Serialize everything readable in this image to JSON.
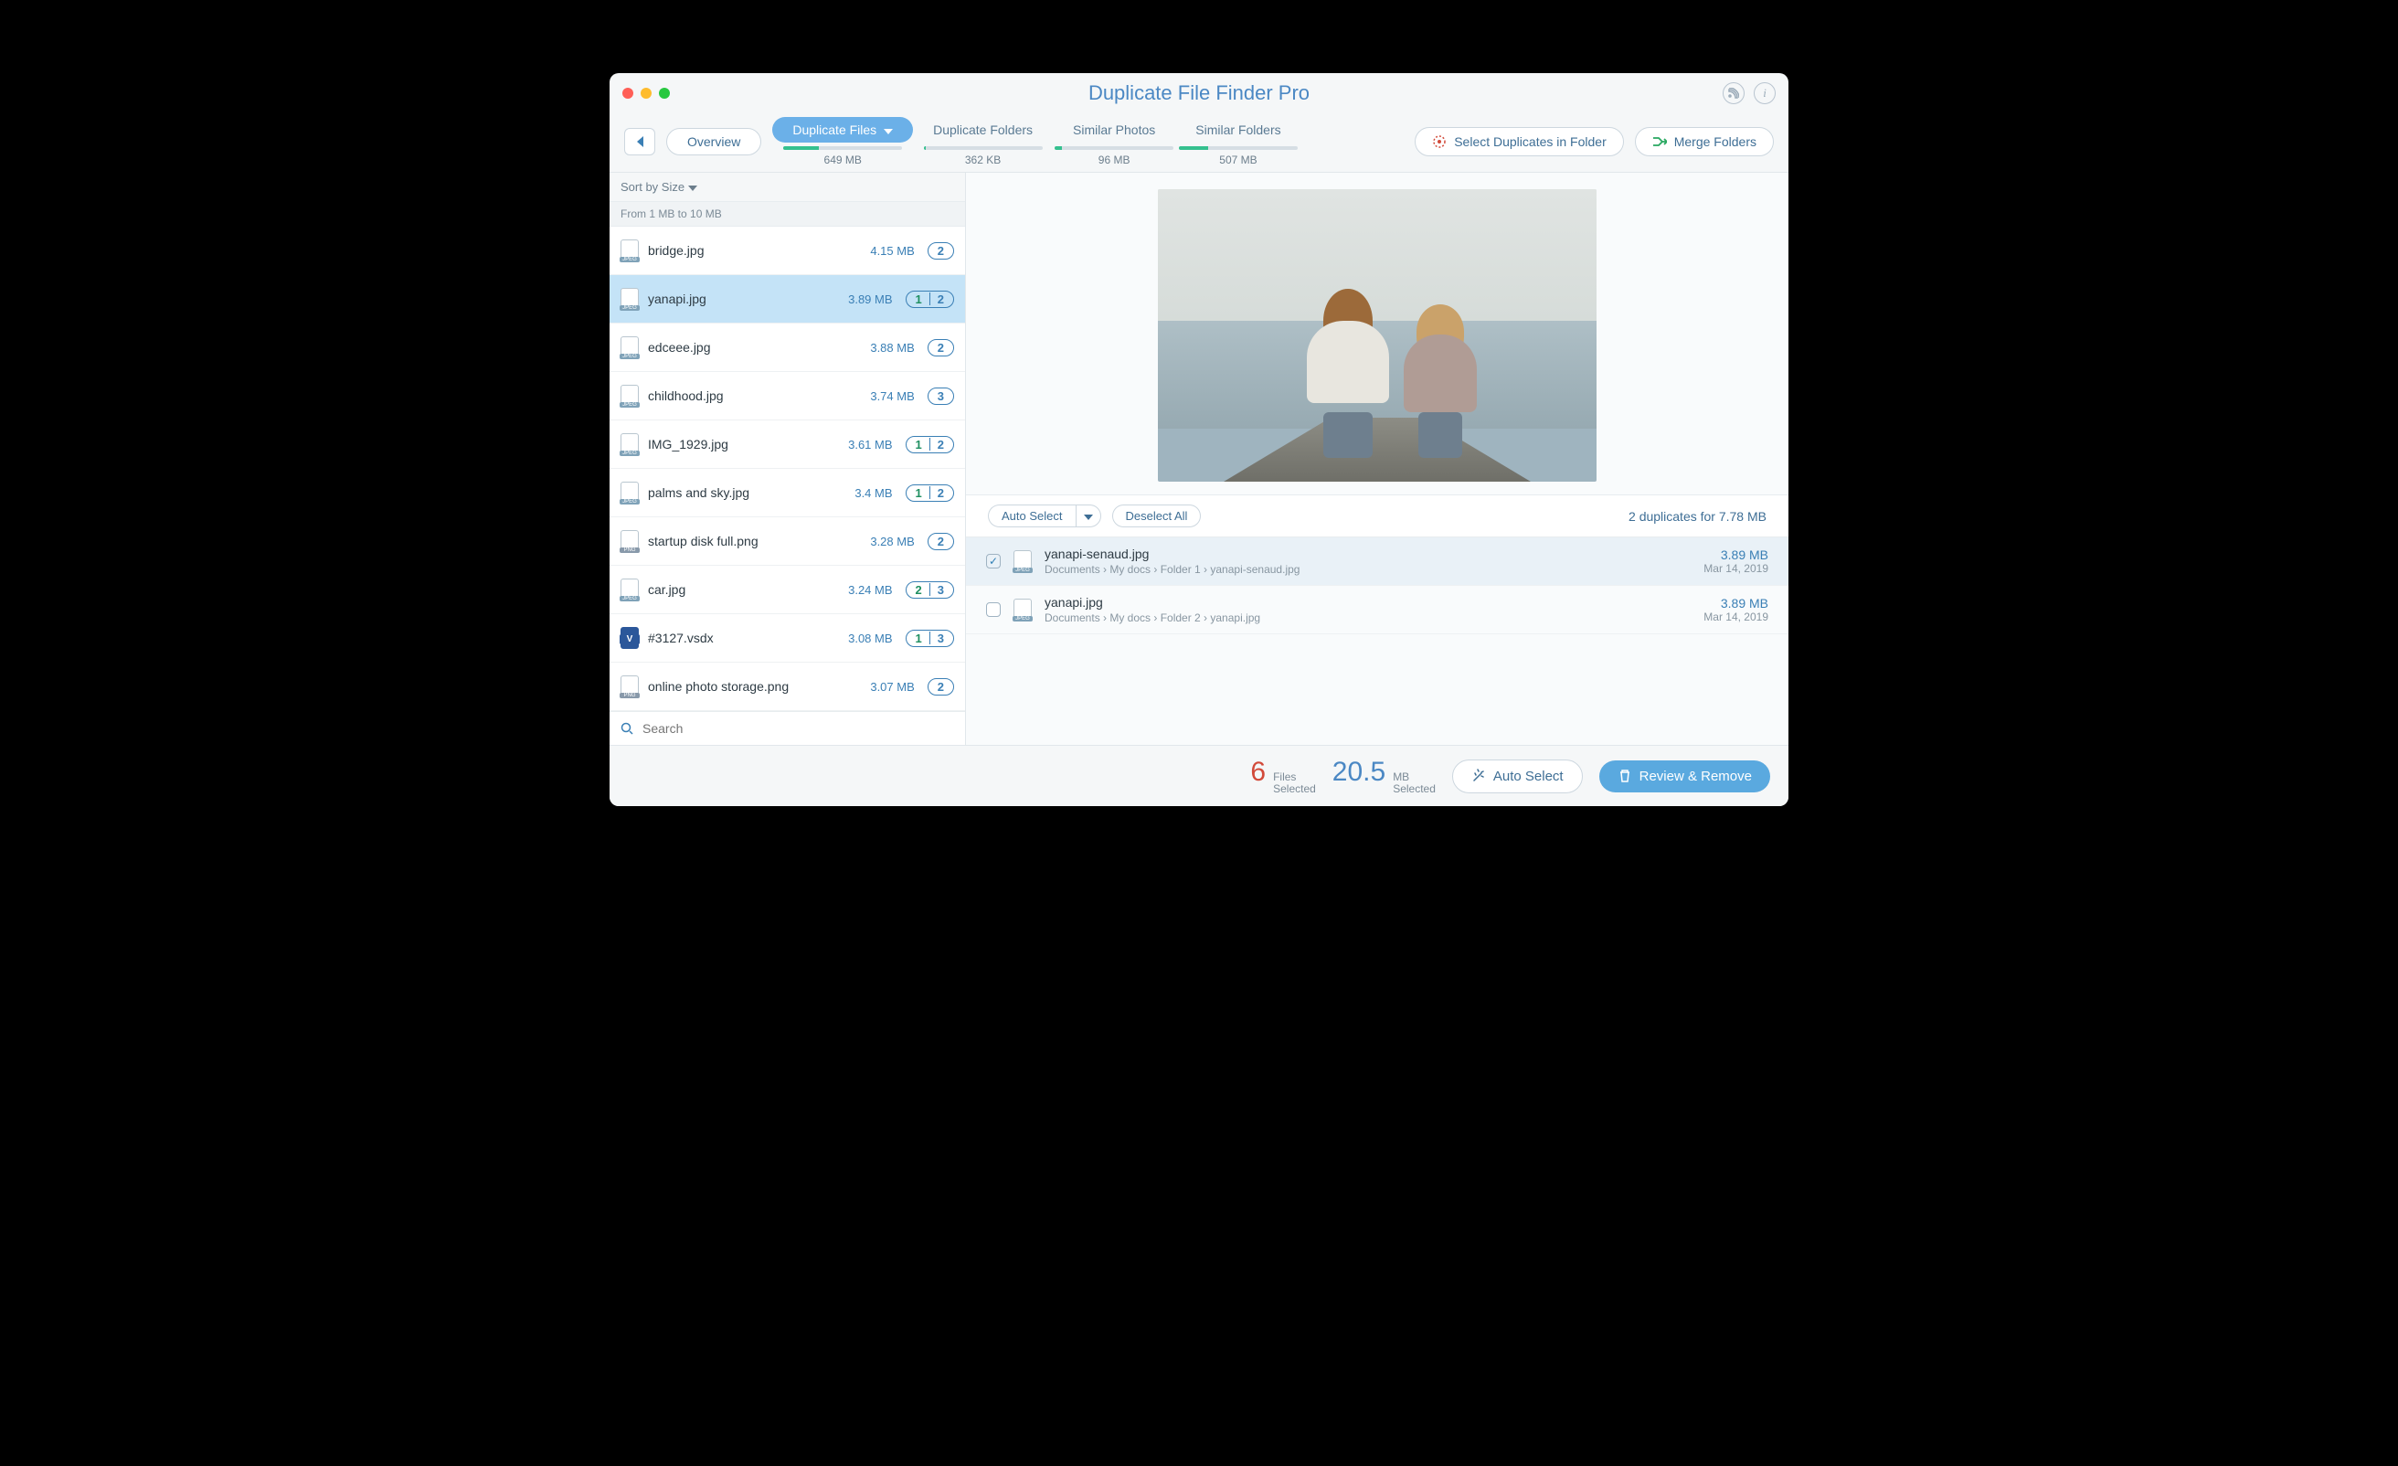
{
  "title": "Duplicate File Finder Pro",
  "nav": {
    "overview": "Overview",
    "tabs": [
      {
        "label": "Duplicate Files",
        "size": "649 MB",
        "fill": 30,
        "active": true
      },
      {
        "label": "Duplicate Folders",
        "size": "362 KB",
        "fill": 2,
        "active": false
      },
      {
        "label": "Similar Photos",
        "size": "96 MB",
        "fill": 6,
        "active": false
      },
      {
        "label": "Similar Folders",
        "size": "507 MB",
        "fill": 25,
        "active": false
      }
    ],
    "select_in_folder": "Select Duplicates in Folder",
    "merge": "Merge Folders"
  },
  "sidebar": {
    "sort": "Sort by Size",
    "group": "From 1 MB to 10 MB",
    "search_placeholder": "Search",
    "items": [
      {
        "name": "bridge.jpg",
        "size": "4.15 MB",
        "badge": [
          "2"
        ],
        "type": "jpeg"
      },
      {
        "name": "yanapi.jpg",
        "size": "3.89 MB",
        "badge": [
          "1",
          "2"
        ],
        "type": "jpeg",
        "selected": true,
        "first_on": true
      },
      {
        "name": "edceee.jpg",
        "size": "3.88 MB",
        "badge": [
          "2"
        ],
        "type": "jpeg"
      },
      {
        "name": "childhood.jpg",
        "size": "3.74 MB",
        "badge": [
          "3"
        ],
        "type": "jpeg"
      },
      {
        "name": "IMG_1929.jpg",
        "size": "3.61 MB",
        "badge": [
          "1",
          "2"
        ],
        "type": "jpeg",
        "first_on": true
      },
      {
        "name": "palms and sky.jpg",
        "size": "3.4 MB",
        "badge": [
          "1",
          "2"
        ],
        "type": "jpeg",
        "first_on": true
      },
      {
        "name": "startup disk full.png",
        "size": "3.28 MB",
        "badge": [
          "2"
        ],
        "type": "png"
      },
      {
        "name": "car.jpg",
        "size": "3.24 MB",
        "badge": [
          "2",
          "3"
        ],
        "type": "jpeg",
        "first_on": true
      },
      {
        "name": "#3127.vsdx",
        "size": "3.08 MB",
        "badge": [
          "1",
          "3"
        ],
        "type": "vsdx",
        "first_on": true
      },
      {
        "name": "online photo storage.png",
        "size": "3.07 MB",
        "badge": [
          "2"
        ],
        "type": "png"
      }
    ]
  },
  "detail": {
    "auto_select": "Auto Select",
    "deselect": "Deselect All",
    "summary": "2 duplicates for 7.78 MB",
    "dups": [
      {
        "name": "yanapi-senaud.jpg",
        "path": "Documents  ›  My docs  ›  Folder 1  ›  yanapi-senaud.jpg",
        "size": "3.89 MB",
        "date": "Mar 14, 2019",
        "checked": true
      },
      {
        "name": "yanapi.jpg",
        "path": "Documents  ›  My docs  ›  Folder 2  ›  yanapi.jpg",
        "size": "3.89 MB",
        "date": "Mar 14, 2019",
        "checked": false
      }
    ]
  },
  "footer": {
    "files_n": "6",
    "files_lbl": "Files\nSelected",
    "size_n": "20.5",
    "size_lbl": "MB\nSelected",
    "auto": "Auto Select",
    "review": "Review & Remove"
  }
}
